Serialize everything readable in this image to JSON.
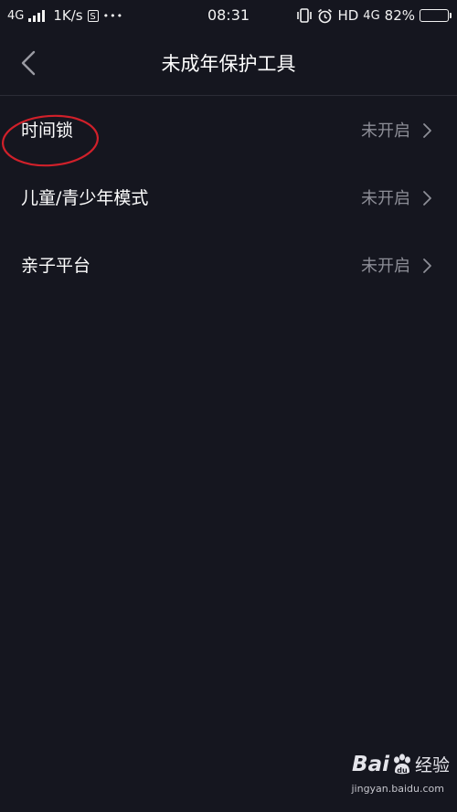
{
  "status_bar": {
    "network_left": "4G",
    "speed": "1K/s",
    "s_badge": "S",
    "more": "•••",
    "time": "08:31",
    "hd": "HD",
    "network_right": "4G",
    "battery_text": "82%",
    "battery_level": 0.82
  },
  "nav": {
    "title": "未成年保护工具",
    "back_icon": "chevron-left-icon"
  },
  "items": [
    {
      "label": "时间锁",
      "status": "未开启"
    },
    {
      "label": "儿童/青少年模式",
      "status": "未开启"
    },
    {
      "label": "亲子平台",
      "status": "未开启"
    }
  ],
  "annotation": {
    "color": "#d0202a"
  },
  "watermark": {
    "brand_bai": "Bai",
    "brand_jingyan": "经验",
    "url": "jingyan.baidu.com"
  },
  "colors": {
    "background": "#15161f",
    "text_primary": "#ffffff",
    "text_secondary": "#8d8e97",
    "divider": "#2b2c36"
  }
}
